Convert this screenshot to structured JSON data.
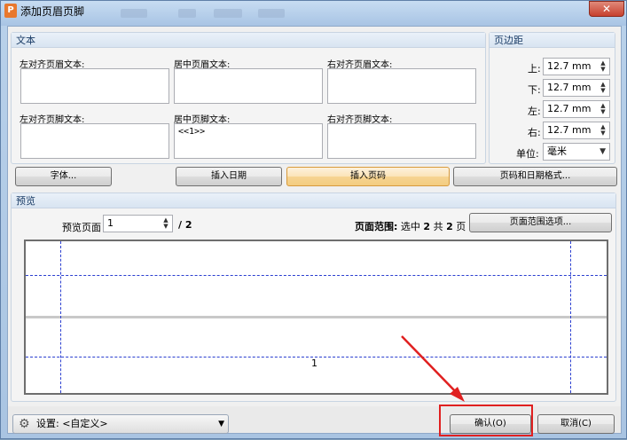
{
  "window": {
    "title": "添加页眉页脚",
    "app_icon": "P",
    "close_glyph": "✕"
  },
  "text_group": {
    "title": "文本",
    "header_left_label": "左对齐页眉文本:",
    "header_center_label": "居中页眉文本:",
    "header_right_label": "右对齐页眉文本:",
    "footer_left_label": "左对齐页脚文本:",
    "footer_center_label": "居中页脚文本:",
    "footer_right_label": "右对齐页脚文本:",
    "header_left_value": "",
    "header_center_value": "",
    "header_right_value": "",
    "footer_left_value": "",
    "footer_center_value": "<<1>>",
    "footer_right_value": ""
  },
  "margins_group": {
    "title": "页边距",
    "top_label": "上:",
    "bottom_label": "下:",
    "left_label": "左:",
    "right_label": "右:",
    "top_value": "12.7 mm",
    "bottom_value": "12.7 mm",
    "left_value": "12.7 mm",
    "right_value": "12.7 mm",
    "unit_label": "单位:",
    "unit_value": "毫米"
  },
  "buttons": {
    "font": "字体...",
    "insert_date": "插入日期",
    "insert_page_number": "插入页码",
    "page_date_format": "页码和日期格式..."
  },
  "preview_group": {
    "title": "预览",
    "preview_page_label": "预览页面",
    "preview_page_value": "1",
    "page_total": "/ 2",
    "page_range_label": "页面范围:",
    "page_range_prefix": "选中",
    "page_range_selected": "2",
    "page_range_mid": "共",
    "page_range_total": "2",
    "page_range_suffix": "页",
    "page_range_options": "页面范围选项...",
    "page_number_shown": "1"
  },
  "footer": {
    "settings_label": "设置:",
    "settings_value": "<自定义>",
    "ok": "确认(O)",
    "cancel": "取消(C)"
  },
  "colors": {
    "guide_lines": "#2b3fd0",
    "highlight": "#e02020",
    "active_button": "#f6d492"
  },
  "icons": {
    "gear": "gear-icon",
    "spin": "spin-arrows-icon",
    "dropdown": "chevron-down-icon"
  }
}
